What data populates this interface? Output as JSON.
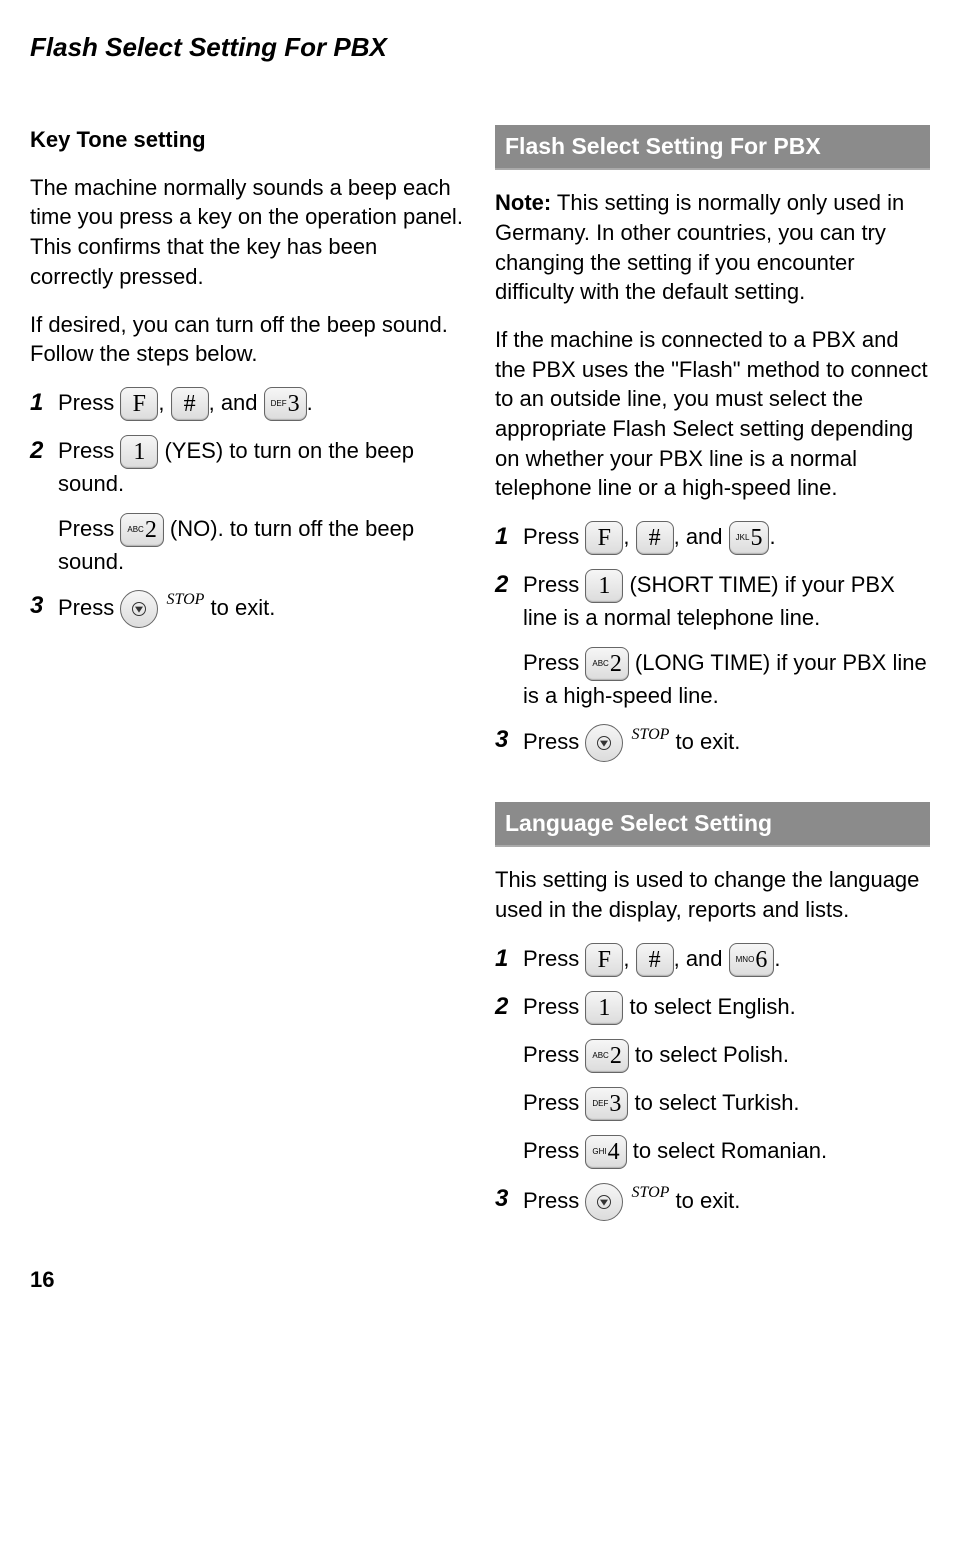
{
  "page_title": "Flash Select Setting For PBX",
  "page_number": "16",
  "stop_label": "STOP",
  "key_tone": {
    "heading": "Key Tone setting",
    "intro1": "The machine normally sounds a beep each time you press a key on the operation panel. This confirms that the key has been correctly pressed.",
    "intro2": "If desired, you can turn off the beep sound. Follow the steps below.",
    "step1": {
      "num": "1",
      "prefix": "Press ",
      "keys": {
        "f": "F",
        "hash": "#",
        "d3_sup": "DEF",
        "d3": "3"
      },
      "sep": ", ",
      "and": ", and ",
      "end": "."
    },
    "step2": {
      "num": "2",
      "prefix": "Press ",
      "key1": "1",
      "after1": " (YES) to turn on the beep sound.",
      "sub_prefix": "Press ",
      "key2_sup": "ABC",
      "key2": "2",
      "sub_after": " (NO). to turn off the beep sound."
    },
    "step3": {
      "num": "3",
      "prefix": "Press ",
      "after": " to exit."
    }
  },
  "flash": {
    "heading": "Flash Select Setting For PBX",
    "note_label": "Note:",
    "note_text": " This setting is normally only used in Germany. In other countries, you can try changing the setting if you encounter difficulty with the default setting.",
    "intro": "If the machine is connected to a PBX and the PBX uses the \"Flash\" method to connect to an outside line, you must select the appropriate Flash Select setting depending on whether your PBX line is a normal telephone line or a high-speed line.",
    "step1": {
      "num": "1",
      "prefix": "Press ",
      "keys": {
        "f": "F",
        "hash": "#",
        "d5_sup": "JKL",
        "d5": "5"
      },
      "sep": ", ",
      "and": ", and ",
      "end": "."
    },
    "step2": {
      "num": "2",
      "prefix": "Press ",
      "key1": "1",
      "after1": " (SHORT TIME) if your PBX line is a normal telephone line.",
      "sub_prefix": "Press ",
      "key2_sup": "ABC",
      "key2": "2",
      "sub_after": " (LONG TIME) if your PBX line is a high-speed line."
    },
    "step3": {
      "num": "3",
      "prefix": "Press ",
      "after": " to exit."
    }
  },
  "lang": {
    "heading": "Language Select Setting",
    "intro": "This setting is used to change the language used in the display, reports and lists.",
    "step1": {
      "num": "1",
      "prefix": "Press ",
      "keys": {
        "f": "F",
        "hash": "#",
        "d6_sup": "MNO",
        "d6": "6"
      },
      "sep": ", ",
      "and": ", and ",
      "end": "."
    },
    "step2": {
      "num": "2",
      "lines": [
        {
          "prefix": "Press ",
          "key_sup": "",
          "key": "1",
          "after": " to select English."
        },
        {
          "prefix": "Press ",
          "key_sup": "ABC",
          "key": "2",
          "after": " to select Polish."
        },
        {
          "prefix": "Press ",
          "key_sup": "DEF",
          "key": "3",
          "after": " to select Turkish."
        },
        {
          "prefix": "Press ",
          "key_sup": "GHI",
          "key": "4",
          "after": " to select Romanian."
        }
      ]
    },
    "step3": {
      "num": "3",
      "prefix": "Press ",
      "after": " to exit."
    }
  }
}
